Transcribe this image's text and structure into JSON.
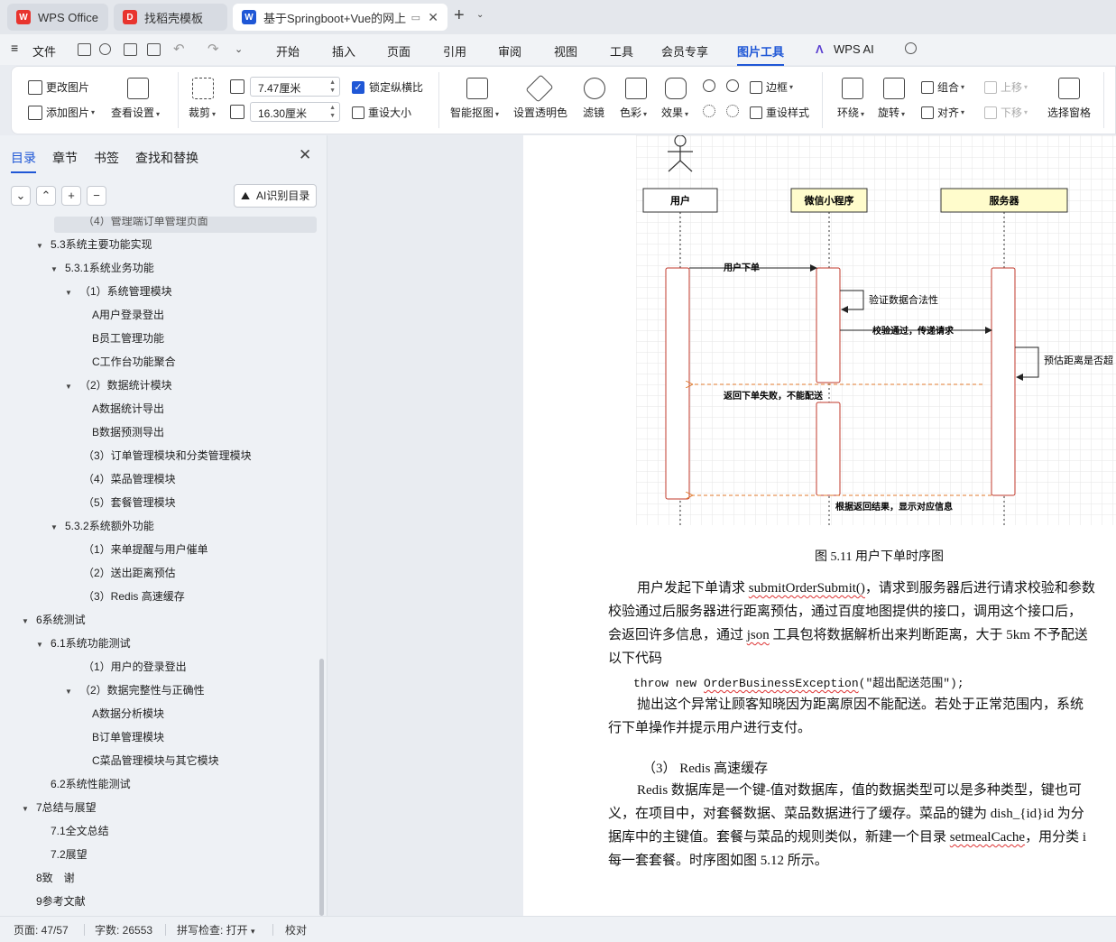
{
  "tabs": [
    {
      "label": "WPS Office",
      "active": false
    },
    {
      "label": "找稻壳模板",
      "active": false
    },
    {
      "label": "基于Springboot+Vue的网上",
      "active": true
    }
  ],
  "menu": {
    "file": "文件",
    "items": [
      "开始",
      "插入",
      "页面",
      "引用",
      "审阅",
      "视图",
      "工具",
      "会员专享",
      "图片工具",
      "WPS AI"
    ],
    "active": "图片工具"
  },
  "ribbon": {
    "change_image": "更改图片",
    "add_image": "添加图片",
    "view_settings": "查看设置",
    "crop": "裁剪",
    "width_value": "7.47厘米",
    "height_value": "16.30厘米",
    "lock_ratio": "锁定纵横比",
    "reset_size": "重设大小",
    "smart_cutout": "智能抠图",
    "set_transparent": "设置透明色",
    "filter": "滤镜",
    "color": "色彩",
    "effect": "效果",
    "border": "边框",
    "reset_style": "重设样式",
    "wrap": "环绕",
    "rotate": "旋转",
    "group": "组合",
    "align": "对齐",
    "move_up": "上移",
    "move_down": "下移",
    "select_pane": "选择窗格"
  },
  "left_panel": {
    "tabs": [
      "目录",
      "章节",
      "书签",
      "查找和替换"
    ],
    "active_tab": "目录",
    "ai_button": "AI识别目录",
    "toc": [
      {
        "label": "（4）管理端订单管理页面",
        "level": 4,
        "arrow": false
      },
      {
        "label": "5.3系统主要功能实现",
        "level": 2,
        "arrow": true
      },
      {
        "label": "5.3.1系统业务功能",
        "level": 3,
        "arrow": true
      },
      {
        "label": "（1）系统管理模块",
        "level": 4,
        "arrow": true
      },
      {
        "label": "A用户登录登出",
        "level": 5,
        "arrow": false
      },
      {
        "label": "B员工管理功能",
        "level": 5,
        "arrow": false
      },
      {
        "label": "C工作台功能聚合",
        "level": 5,
        "arrow": false
      },
      {
        "label": "（2）数据统计模块",
        "level": 4,
        "arrow": true
      },
      {
        "label": "A数据统计导出",
        "level": 5,
        "arrow": false
      },
      {
        "label": "B数据预测导出",
        "level": 5,
        "arrow": false
      },
      {
        "label": "（3）订单管理模块和分类管理模块",
        "level": 4,
        "arrow": false
      },
      {
        "label": "（4）菜品管理模块",
        "level": 4,
        "arrow": false
      },
      {
        "label": "（5）套餐管理模块",
        "level": 4,
        "arrow": false
      },
      {
        "label": "5.3.2系统额外功能",
        "level": 3,
        "arrow": true
      },
      {
        "label": "（1）来单提醒与用户催单",
        "level": 4,
        "arrow": false
      },
      {
        "label": "（2）送出距离预估",
        "level": 4,
        "arrow": false
      },
      {
        "label": "（3）Redis 高速缓存",
        "level": 4,
        "arrow": false
      },
      {
        "label": "6系统测试",
        "level": 1,
        "arrow": true
      },
      {
        "label": "6.1系统功能测试",
        "level": 2,
        "arrow": true
      },
      {
        "label": "（1）用户的登录登出",
        "level": 4,
        "arrow": false
      },
      {
        "label": "（2）数据完整性与正确性",
        "level": 4,
        "arrow": true
      },
      {
        "label": "A数据分析模块",
        "level": 5,
        "arrow": false
      },
      {
        "label": "B订单管理模块",
        "level": 5,
        "arrow": false
      },
      {
        "label": "C菜品管理模块与其它模块",
        "level": 5,
        "arrow": false
      },
      {
        "label": "6.2系统性能测试",
        "level": 2,
        "arrow": false
      },
      {
        "label": "7总结与展望",
        "level": 1,
        "arrow": true
      },
      {
        "label": "7.1全文总结",
        "level": 2,
        "arrow": false
      },
      {
        "label": "7.2展望",
        "level": 2,
        "arrow": false
      },
      {
        "label": "8致　谢",
        "level": 1,
        "arrow": false
      },
      {
        "label": "9参考文献",
        "level": 1,
        "arrow": false
      }
    ]
  },
  "diagram": {
    "lifelines": [
      "用户",
      "微信小程序",
      "服务器"
    ],
    "messages": [
      "用户下单",
      "验证数据合法性",
      "校验通过，传递请求",
      "预估距离是否超",
      "返回下单失败，不能配送",
      "根据返回结果，显示对应信息"
    ]
  },
  "document": {
    "caption": "图 5.11  用户下单时序图",
    "para1": [
      [
        "用户发起下单请求 ",
        "submitOrderSubmit()",
        "，请求到服务器后进行请求校验和参数"
      ],
      [
        "校验通过后服务器进行距离预估，通过百度地图提供的接口，调用这个接口后，"
      ],
      [
        "会返回许多信息，通过 ",
        "json",
        " 工具包将数据解析出来判断距离，大于 5km 不予配送"
      ],
      [
        "以下代码"
      ]
    ],
    "code_prefix": "throw new ",
    "code_class": "OrderBusinessException",
    "code_suffix": "(\"超出配送范围\");",
    "para2_line1": "抛出这个异常让顾客知晓因为距离原因不能配送。若处于正常范围内，系统",
    "para2_line2": "行下单操作并提示用户进行支付。",
    "heading": "（3）  Redis 高速缓存",
    "para3_line1": "Redis 数据库是一个键-值对数据库，值的数据类型可以是多种类型，键也可",
    "para3_line2_a": "义，在项目中，对套餐数据、菜品数据进行了缓存。菜品的键为 dish_{id}id 为分",
    "para3_line3_a": "据库中的主键值。套餐与菜品的规则类似，新建一个目录 ",
    "para3_line3_b": "setmealCache",
    "para3_line3_c": "，用分类 i",
    "para3_line4": "每一套套餐。时序图如图  5.12 所示。"
  },
  "status": {
    "page": "页面: 47/57",
    "words": "字数: 26553",
    "spell": "拼写检查: 打开",
    "proof": "校对"
  },
  "colors": {
    "accent": "#1f57d6",
    "wps_red": "#e8342e",
    "lifeline_yellow": "#fffccc",
    "activation_red": "#c0392b",
    "return_orange": "#e07a2c"
  }
}
